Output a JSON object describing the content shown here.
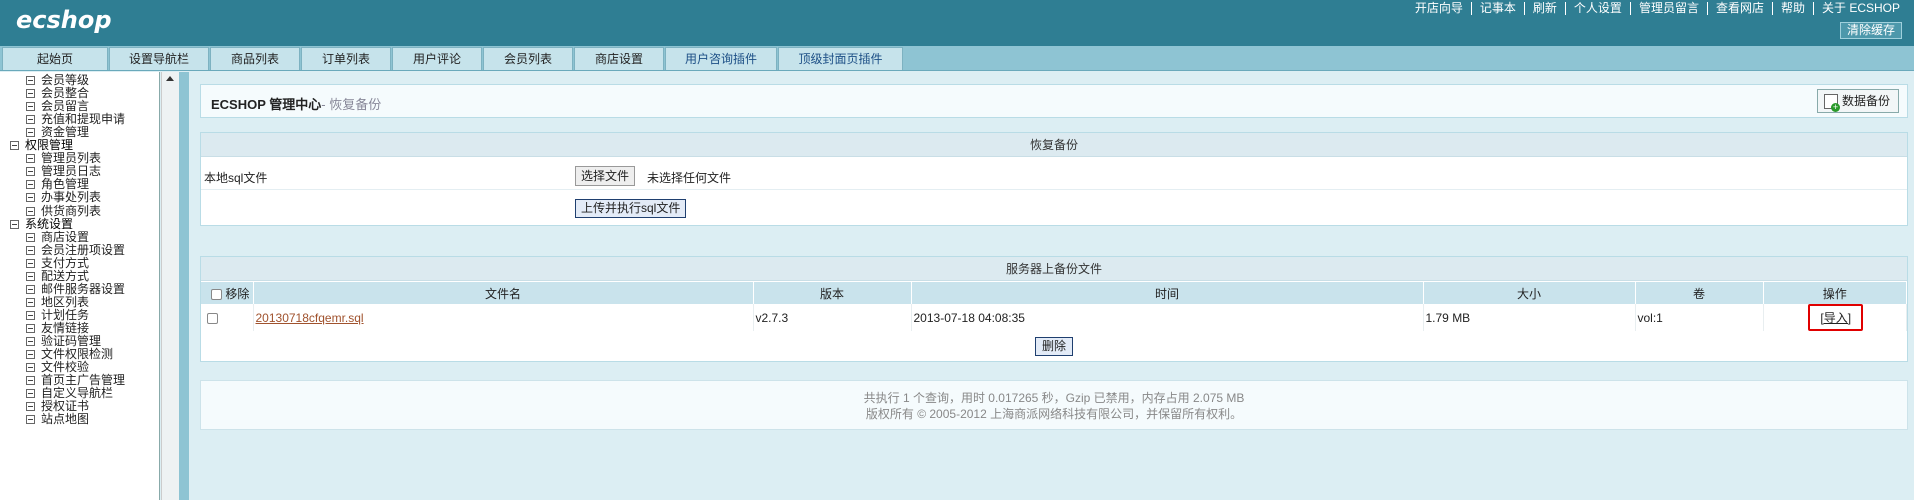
{
  "header": {
    "logo": "ecshop",
    "nav": [
      "开店向导",
      "记事本",
      "刷新",
      "个人设置",
      "管理员留言",
      "查看网店",
      "帮助",
      "关于 ECSHOP"
    ],
    "clear_cache": "清除缓存"
  },
  "tabs": [
    {
      "label": "起始页"
    },
    {
      "label": "设置导航栏"
    },
    {
      "label": "商品列表"
    },
    {
      "label": "订单列表"
    },
    {
      "label": "用户评论"
    },
    {
      "label": "会员列表"
    },
    {
      "label": "商店设置"
    },
    {
      "label": "用户咨询插件"
    },
    {
      "label": "顶级封面页插件"
    }
  ],
  "sidebar": {
    "items": [
      {
        "label": "会员等级",
        "group": false
      },
      {
        "label": "会员整合",
        "group": false
      },
      {
        "label": "会员留言",
        "group": false
      },
      {
        "label": "充值和提现申请",
        "group": false
      },
      {
        "label": "资金管理",
        "group": false
      },
      {
        "label": "权限管理",
        "group": true
      },
      {
        "label": "管理员列表",
        "group": false
      },
      {
        "label": "管理员日志",
        "group": false
      },
      {
        "label": "角色管理",
        "group": false
      },
      {
        "label": "办事处列表",
        "group": false
      },
      {
        "label": "供货商列表",
        "group": false
      },
      {
        "label": "系统设置",
        "group": true
      },
      {
        "label": "商店设置",
        "group": false
      },
      {
        "label": "会员注册项设置",
        "group": false
      },
      {
        "label": "支付方式",
        "group": false
      },
      {
        "label": "配送方式",
        "group": false
      },
      {
        "label": "邮件服务器设置",
        "group": false
      },
      {
        "label": "地区列表",
        "group": false
      },
      {
        "label": "计划任务",
        "group": false
      },
      {
        "label": "友情链接",
        "group": false
      },
      {
        "label": "验证码管理",
        "group": false
      },
      {
        "label": "文件权限检测",
        "group": false
      },
      {
        "label": "文件校验",
        "group": false
      },
      {
        "label": "首页主广告管理",
        "group": false
      },
      {
        "label": "自定义导航栏",
        "group": false
      },
      {
        "label": "授权证书",
        "group": false
      },
      {
        "label": "站点地图",
        "group": false
      }
    ]
  },
  "page": {
    "title": "ECSHOP 管理中心",
    "subtitle": "- 恢复备份",
    "backup_button": "数据备份"
  },
  "restore": {
    "heading": "恢复备份",
    "local_sql_label": "本地sql文件",
    "choose_file": "选择文件",
    "no_file": "未选择任何文件",
    "upload_button": "上传并执行sql文件"
  },
  "server_files": {
    "heading": "服务器上备份文件",
    "columns": [
      "移除",
      "文件名",
      "版本",
      "时间",
      "大小",
      "卷",
      "操作"
    ],
    "rows": [
      {
        "filename": "20130718cfqemr.sql",
        "version": "v2.7.3",
        "time": "2013-07-18 04:08:35",
        "size": "1.79 MB",
        "volume": "vol:1",
        "action": "[导入]"
      }
    ],
    "delete_button": "删除"
  },
  "footer": {
    "line1": "共执行 1 个查询，用时 0.017265 秒，Gzip 已禁用，内存占用 2.075 MB",
    "line2": "版权所有 © 2005-2012 上海商派网络科技有限公司，并保留所有权利。"
  }
}
